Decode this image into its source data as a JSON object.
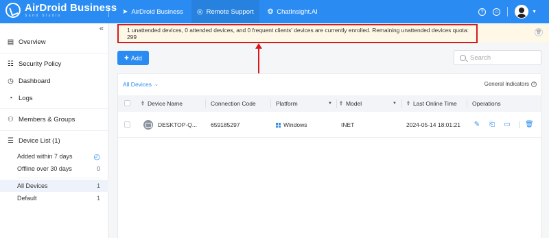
{
  "app": {
    "logo_title": "AirDroid Business",
    "logo_subtitle": "Sand Studio"
  },
  "topnav": [
    {
      "label": "AirDroid Business",
      "icon": "send-icon",
      "active": false
    },
    {
      "label": "Remote Support",
      "icon": "lifebuoy-icon",
      "active": true
    },
    {
      "label": "ChatInsight.AI",
      "icon": "ai-chat-icon",
      "active": false
    }
  ],
  "sidebar": {
    "collapse_glyph": "«",
    "items": [
      {
        "label": "Overview",
        "icon": "overview-icon"
      },
      {
        "label": "Security Policy",
        "icon": "security-policy-icon"
      },
      {
        "label": "Dashboard",
        "icon": "dashboard-icon"
      },
      {
        "label": "Logs",
        "icon": "logs-icon"
      },
      {
        "label": "Members & Groups",
        "icon": "members-icon"
      },
      {
        "label": "Device List (1)",
        "icon": "device-list-icon"
      }
    ],
    "device_filters": [
      {
        "label": "Added within 7 days",
        "count": ""
      },
      {
        "label": "Offline over 30 days",
        "count": "0"
      }
    ],
    "groups": [
      {
        "label": "All Devices",
        "count": "1",
        "selected": true
      },
      {
        "label": "Default",
        "count": "1",
        "selected": false
      }
    ]
  },
  "banner": {
    "text": "1 unattended devices, 0 attended devices, and 0 frequent clients' devices are currently enrolled. Remaining unattended devices quota: 299"
  },
  "toolbar": {
    "add_label": "Add",
    "search_placeholder": "Search"
  },
  "panel": {
    "filter_label": "All Devices",
    "general_indicators_label": "General Indicators"
  },
  "table": {
    "headers": {
      "device_name": "Device Name",
      "connection_code": "Connection Code",
      "platform": "Platform",
      "model": "Model",
      "last_online": "Last Online Time",
      "operations": "Operations"
    },
    "rows": [
      {
        "device_name": "DESKTOP-Q...",
        "connection_code": "659185297",
        "platform": "Windows",
        "model": "INET",
        "last_online": "2024-05-14 18:01:21"
      }
    ]
  },
  "colors": {
    "brand": "#2a8cf2",
    "banner_bg": "#fff8e6",
    "highlight": "#d61a1a"
  }
}
